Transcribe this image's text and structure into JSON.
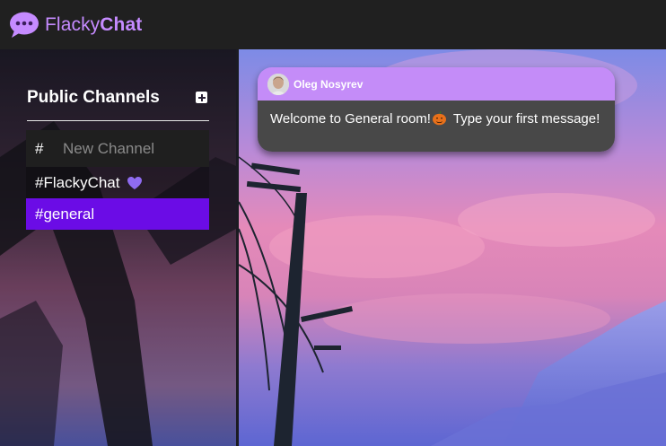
{
  "app": {
    "brand_regular": "Flacky",
    "brand_bold": "Chat",
    "logo_icon": "chat-bubble-icon",
    "accent": "#c58bff"
  },
  "sidebar": {
    "title": "Public Channels",
    "add_icon": "plus-square-icon",
    "new_channel": {
      "prefix": "#",
      "placeholder": "New Channel",
      "value": ""
    },
    "channels": [
      {
        "label": "#FlackyChat",
        "icon": "purple-heart-icon",
        "active": false
      },
      {
        "label": "#general",
        "icon": "",
        "active": true
      }
    ],
    "active_color": "#6b0ce6"
  },
  "messages": [
    {
      "author": "Oleg Nosyrev",
      "avatar": "user-avatar",
      "text_before": "Welcome to General room!",
      "emoji": "pumpkin-icon",
      "text_after": " Type your first message!",
      "header_color": "#c48cf8",
      "body_color": "#484848"
    }
  ]
}
